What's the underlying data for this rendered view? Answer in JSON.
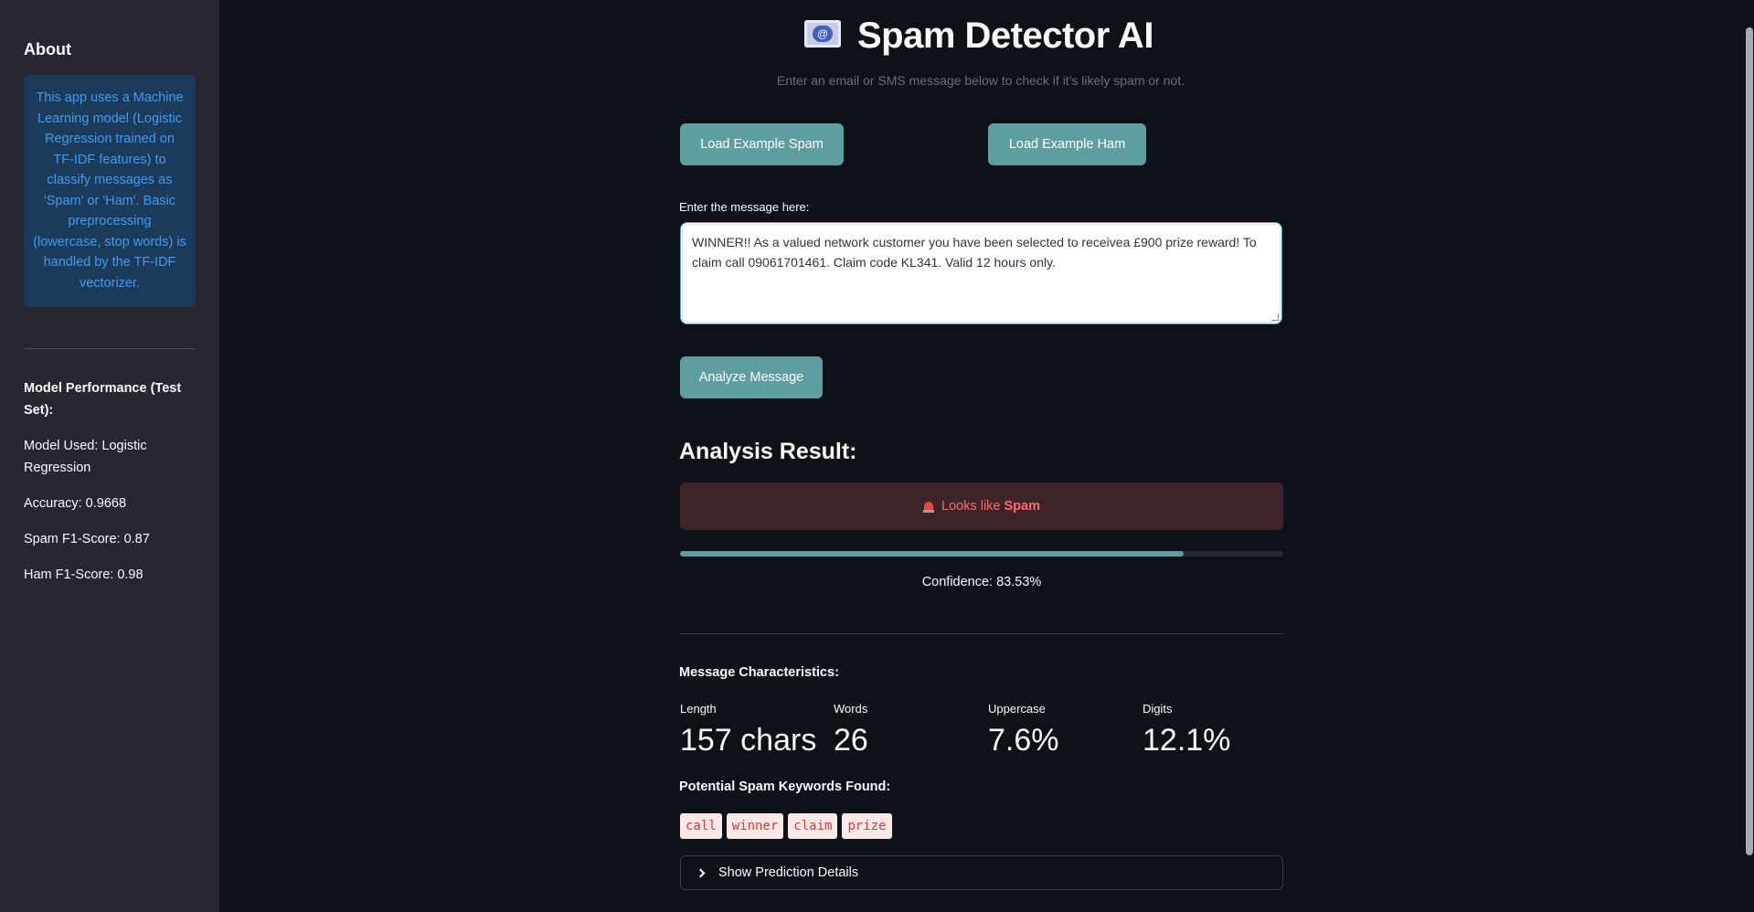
{
  "sidebar": {
    "about_heading": "About",
    "about_text": "This app uses a Machine Learning model (Logistic Regression trained on TF-IDF features) to classify messages as 'Spam' or 'Ham'. Basic preprocessing (lowercase, stop words) is handled by the TF-IDF vectorizer.",
    "performance_heading": "Model Performance (Test Set):",
    "model_used": "Model Used: Logistic Regression",
    "accuracy": "Accuracy: 0.9668",
    "spam_f1": "Spam F1-Score: 0.87",
    "ham_f1": "Ham F1-Score: 0.98"
  },
  "header": {
    "title": "Spam Detector AI",
    "icon": "email-icon",
    "subtitle": "Enter an email or SMS message below to check if it's likely spam or not."
  },
  "buttons": {
    "load_spam": "Load Example Spam",
    "load_ham": "Load Example Ham",
    "analyze": "Analyze Message"
  },
  "input": {
    "label": "Enter the message here:",
    "value": "WINNER!! As a valued network customer you have been selected to receivea £900 prize reward! To claim call 09061701461. Claim code KL341. Valid 12 hours only."
  },
  "result": {
    "heading": "Analysis Result:",
    "prefix": "Looks like",
    "verdict": "Spam",
    "icon": "siren-icon",
    "confidence_fraction": 0.8353,
    "confidence_text": "Confidence: 83.53%"
  },
  "characteristics": {
    "heading": "Message Characteristics:",
    "metrics": [
      {
        "label": "Length",
        "value": "157 chars"
      },
      {
        "label": "Words",
        "value": "26"
      },
      {
        "label": "Uppercase",
        "value": "7.6%"
      },
      {
        "label": "Digits",
        "value": "12.1%"
      }
    ]
  },
  "keywords": {
    "heading": "Potential Spam Keywords Found:",
    "items": [
      "call",
      "winner",
      "claim",
      "prize"
    ]
  },
  "expander": {
    "label": "Show Prediction Details"
  },
  "colors": {
    "accent": "#5f9ea0",
    "background": "#0e1117",
    "sidebar": "#262730",
    "spam_text": "#ff6b6b"
  }
}
